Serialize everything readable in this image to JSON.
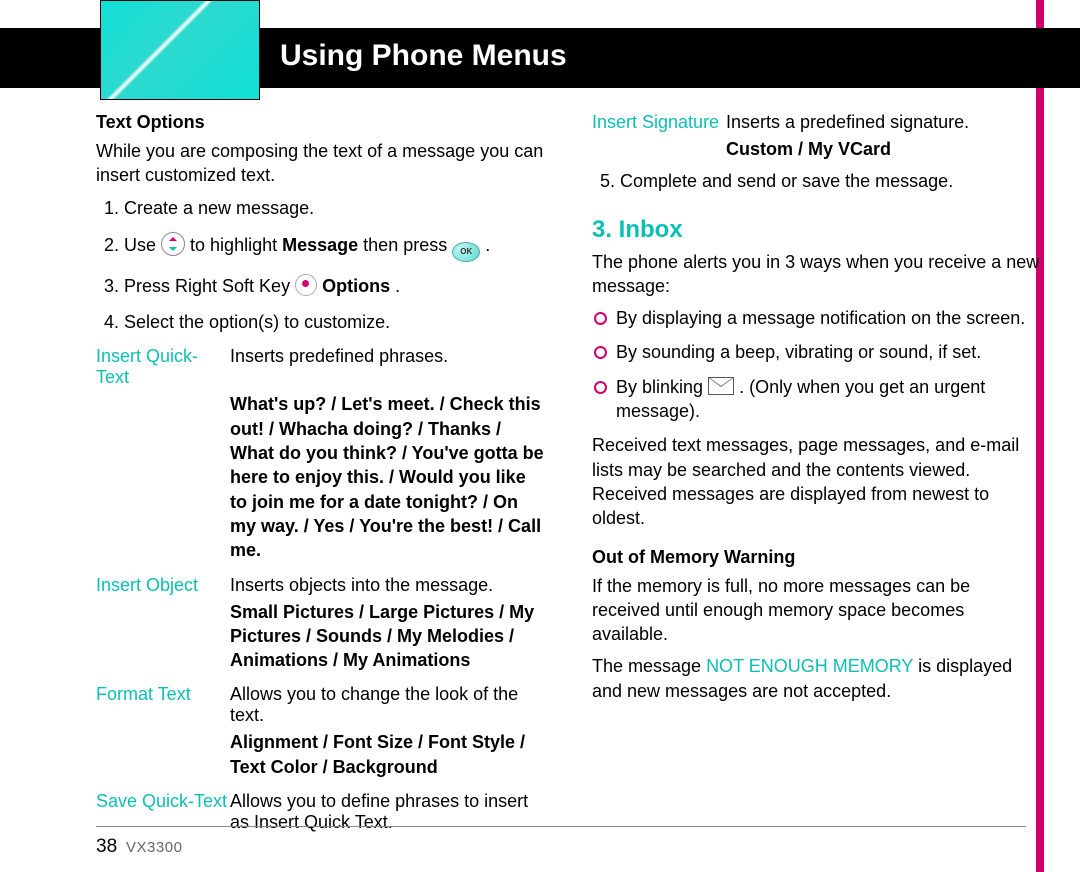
{
  "header": {
    "title": "Using Phone Menus"
  },
  "footer": {
    "page": "38",
    "model": "VX3300"
  },
  "left": {
    "text_options_hd": "Text Options",
    "intro": "While you are composing the text of a message you can insert customized text.",
    "step1": "Create a new message.",
    "step2a": "Use ",
    "step2b": " to highlight ",
    "step2_msg": "Message",
    "step2c": " then press ",
    "step2d": " .",
    "step3a": "Press Right Soft Key ",
    "step3b": "  ",
    "step3_opt": "Options",
    "step3c": ".",
    "step4": "Select the option(s) to customize.",
    "iqt_label": "Insert Quick-Text",
    "iqt_body": "Inserts predefined phrases.",
    "iqt_bold": "What's up? / Let's meet. / Check this out! / Whacha doing? / Thanks / What do you think? / You've gotta be here to enjoy this. / Would you like to join me for a date tonight? / On my way. / Yes / You're the best! / Call me.",
    "io_label": "Insert Object",
    "io_body": "Inserts objects into the message.",
    "io_bold": "Small Pictures / Large Pictures / My Pictures / Sounds / My Melodies / Animations / My Animations",
    "ft_label": "Format Text",
    "ft_body": "Allows you to change the look of the text.",
    "ft_bold": "Alignment / Font Size / Font Style / Text Color / Background",
    "sqt_label": "Save Quick-Text",
    "sqt_body": "Allows you to define phrases to insert as Insert Quick Text."
  },
  "right": {
    "is_label": "Insert Signature",
    "is_body": "Inserts a predefined signature.",
    "is_bold": "Custom / My VCard",
    "step5": "Complete and send or save the message.",
    "inbox_hd": "3. Inbox",
    "inbox_intro": "The phone alerts you in 3 ways when you receive a new message:",
    "b1": "By displaying a message notification on the screen.",
    "b2": "By sounding a beep, vibrating or sound, if set.",
    "b3a": "By blinking ",
    "b3b": " . (Only when you get an urgent message).",
    "inbox_p": "Received text messages, page messages, and e-mail lists may be searched and the contents viewed. Received messages are displayed from newest to oldest.",
    "oom_hd": "Out of Memory Warning",
    "oom_p1": "If the memory is full, no more messages can be received until enough memory space becomes available.",
    "oom_p2a": "The message ",
    "oom_not": "NOT ENOUGH MEMORY",
    "oom_p2b": " is displayed and new messages are not accepted."
  }
}
